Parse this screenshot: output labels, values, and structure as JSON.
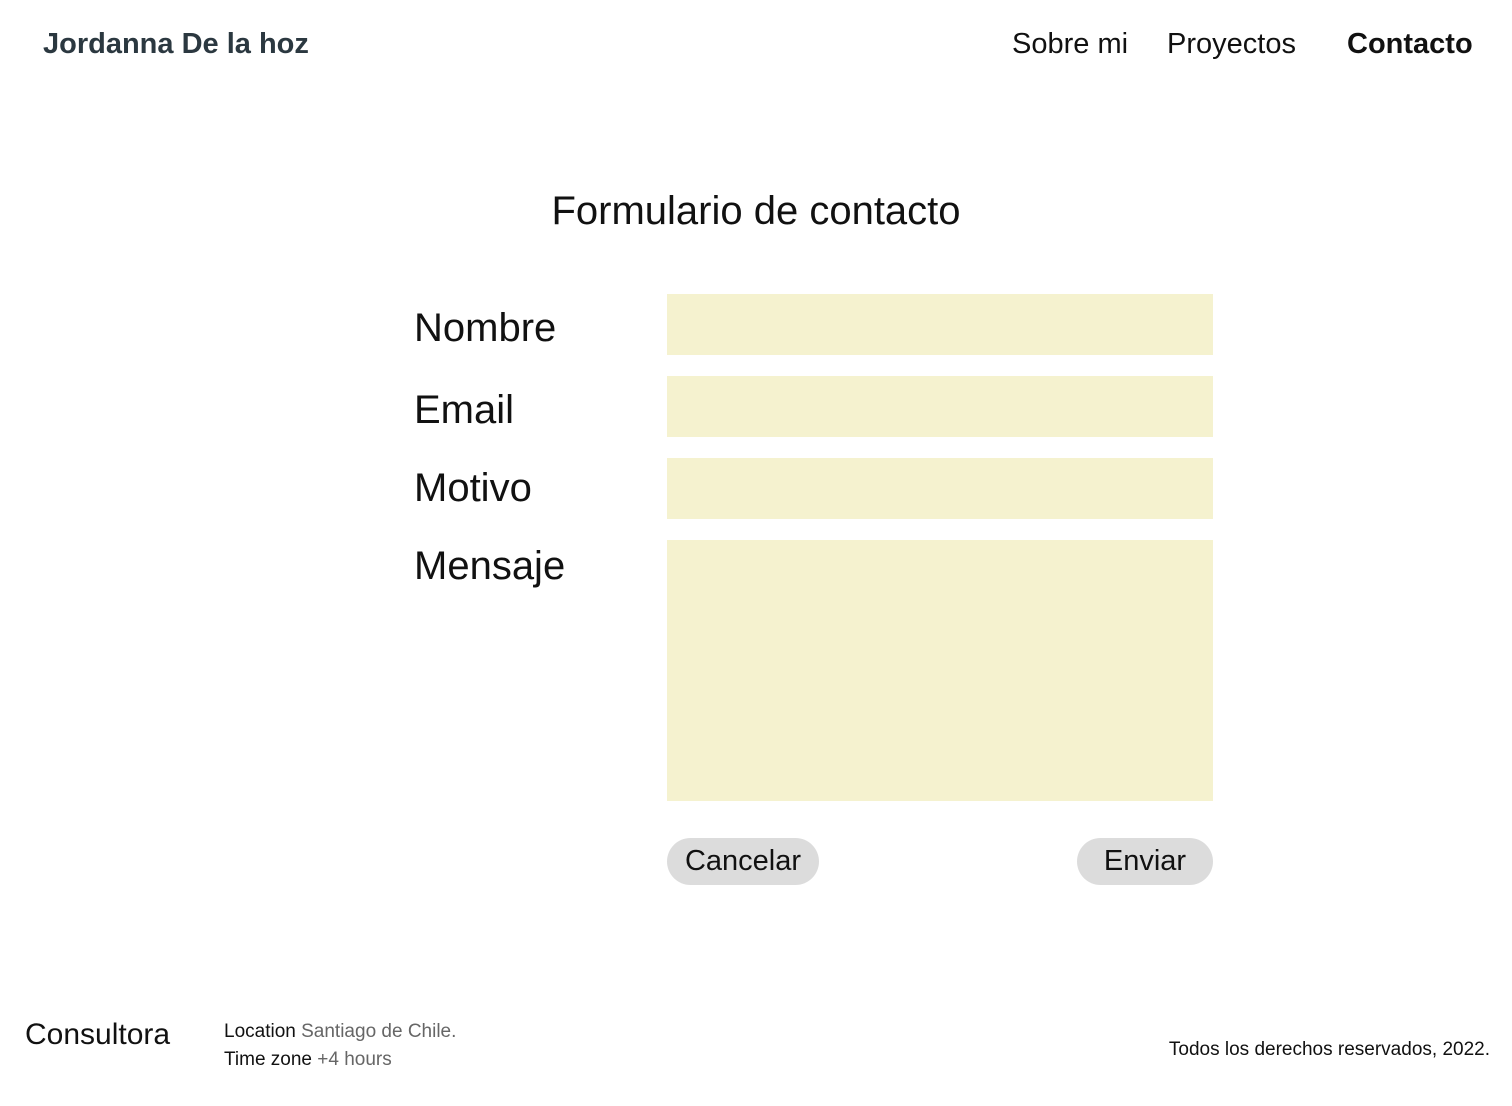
{
  "header": {
    "brand": "Jordanna De la hoz",
    "nav": {
      "about": "Sobre mi",
      "projects": "Proyectos",
      "contact": "Contacto"
    }
  },
  "form": {
    "title": "Formulario de contacto",
    "fields": {
      "name": {
        "label": "Nombre",
        "value": ""
      },
      "email": {
        "label": "Email",
        "value": ""
      },
      "reason": {
        "label": "Motivo",
        "value": ""
      },
      "message": {
        "label": "Mensaje",
        "value": ""
      }
    },
    "buttons": {
      "cancel": "Cancelar",
      "send": "Enviar"
    },
    "field_color": "#f5f2cf",
    "button_color": "#dcdcdc"
  },
  "footer": {
    "brand": "Consultora",
    "location_label": "Location",
    "location_value": "Santiago de Chile.",
    "timezone_label": "Time zone",
    "timezone_value": "+4 hours",
    "copyright": "Todos los derechos reservados, 2022."
  }
}
